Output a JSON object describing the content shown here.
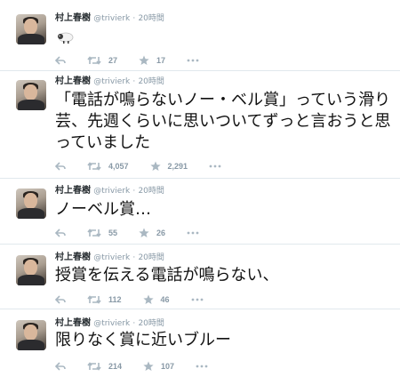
{
  "tweets": [
    {
      "author": "村上春樹",
      "handle": "@trivierk",
      "time": "20時間",
      "text": "",
      "retweets": "27",
      "favorites": "17"
    },
    {
      "author": "村上春樹",
      "handle": "@trivierk",
      "time": "20時間",
      "text": "「電話が鳴らないノー・ベル賞」っていう滑り芸、先週くらいに思いついてずっと言おうと思っていました",
      "retweets": "4,057",
      "favorites": "2,291"
    },
    {
      "author": "村上春樹",
      "handle": "@trivierk",
      "time": "20時間",
      "text": "ノーベル賞…",
      "retweets": "55",
      "favorites": "26"
    },
    {
      "author": "村上春樹",
      "handle": "@trivierk",
      "time": "20時間",
      "text": "授賞を伝える電話が鳴らない、",
      "retweets": "112",
      "favorites": "46"
    },
    {
      "author": "村上春樹",
      "handle": "@trivierk",
      "time": "20時間",
      "text": "限りなく賞に近いブルー",
      "retweets": "214",
      "favorites": "107"
    }
  ],
  "icons": {
    "reply": "reply-icon",
    "retweet": "retweet-icon",
    "favorite": "star-icon",
    "more": "more-icon",
    "attachment": "sheep-emoji-icon"
  },
  "colors": {
    "text": "#292f33",
    "muted": "#8899a6",
    "divider": "#e1e8ed"
  },
  "separator": "·"
}
